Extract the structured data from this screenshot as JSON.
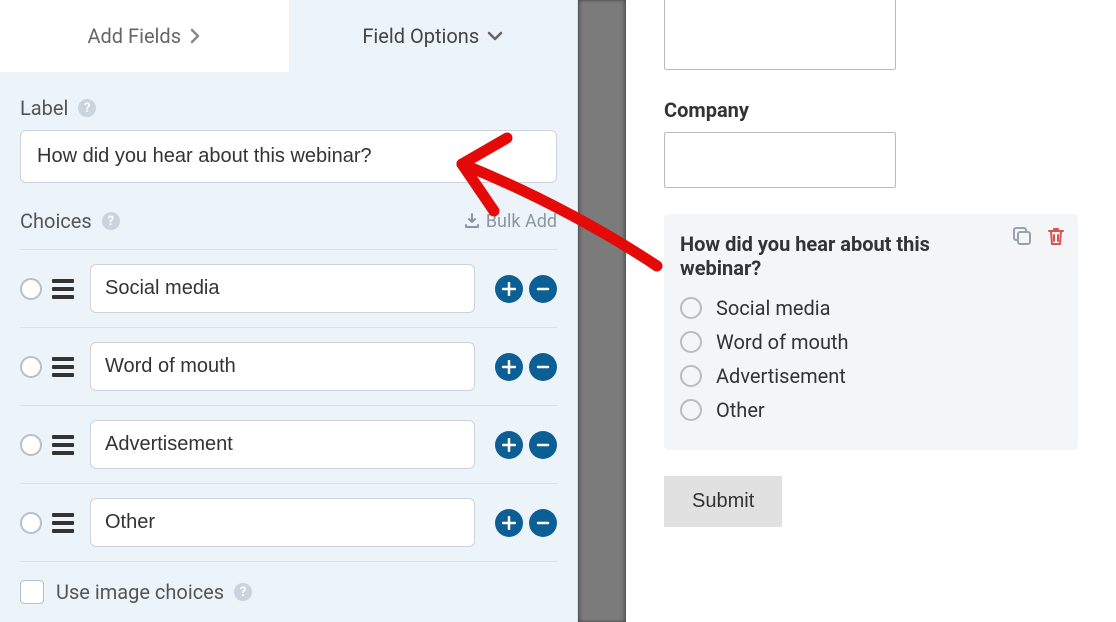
{
  "tabs": {
    "add_fields": "Add Fields",
    "field_options": "Field Options"
  },
  "label_section": {
    "title": "Label",
    "value": "How did you hear about this webinar?"
  },
  "choices_section": {
    "title": "Choices",
    "bulk_add": "Bulk Add",
    "items": [
      {
        "text": "Social media"
      },
      {
        "text": "Word of mouth"
      },
      {
        "text": "Advertisement"
      },
      {
        "text": "Other"
      }
    ],
    "use_image_choices": "Use image choices"
  },
  "preview": {
    "company_label": "Company",
    "selected_field_label": "How did you hear about this webinar?",
    "options": [
      "Social media",
      "Word of mouth",
      "Advertisement",
      "Other"
    ],
    "submit": "Submit"
  }
}
